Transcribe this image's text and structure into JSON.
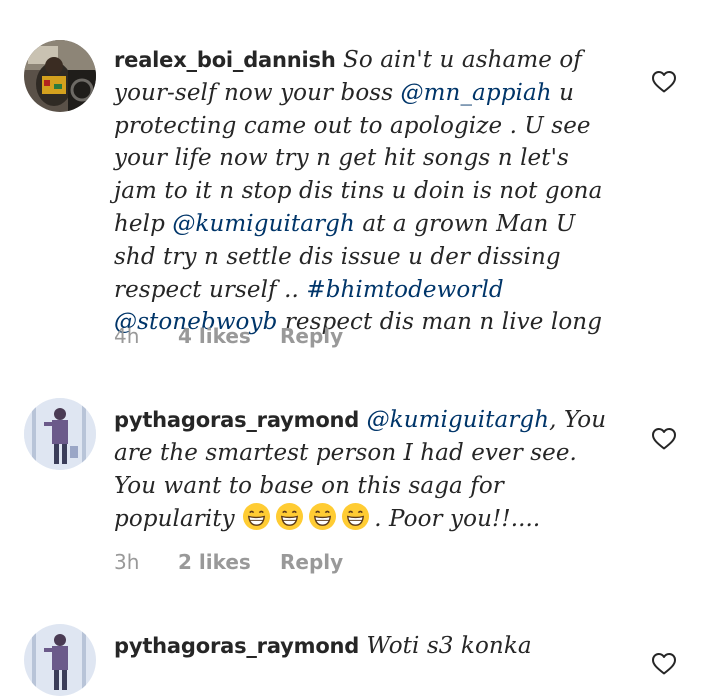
{
  "comments": [
    {
      "username": "realex_boi_dannish",
      "segments": [
        {
          "type": "text",
          "text": " So ain't u ashame of your-self now your boss "
        },
        {
          "type": "mention",
          "text": "@mn_appiah"
        },
        {
          "type": "text",
          "text": " u protecting came out to apologize . U see your life now try n get hit songs n let's jam to it n stop dis tins u doin is not gona help "
        },
        {
          "type": "mention",
          "text": "@kumiguitargh"
        },
        {
          "type": "text",
          "text": " at a grown Man U shd try n settle dis issue u der dissing respect urself .. "
        },
        {
          "type": "hashtag",
          "text": "#bhimtodeworld"
        },
        {
          "type": "text",
          "text": " "
        },
        {
          "type": "mention",
          "text": "@stonebwoyb"
        },
        {
          "type": "text",
          "text": " respect dis man n live long"
        }
      ],
      "time": "4h",
      "likes": "4 likes",
      "reply": "Reply",
      "avatar_icon": "profile-photo-car"
    },
    {
      "username": "pythagoras_raymond",
      "segments": [
        {
          "type": "text",
          "text": " "
        },
        {
          "type": "mention",
          "text": "@kumiguitargh"
        },
        {
          "type": "text",
          "text": ", You are the smartest person I had ever see. You want to base on this saga for popularity "
        },
        {
          "type": "emoji",
          "text": "grinning-face-with-smiling-eyes"
        },
        {
          "type": "emoji",
          "text": "grinning-face-with-smiling-eyes"
        },
        {
          "type": "emoji",
          "text": "grinning-face-with-smiling-eyes"
        },
        {
          "type": "emoji",
          "text": "grinning-face-with-smiling-eyes"
        },
        {
          "type": "text",
          "text": ". Poor you!!...."
        }
      ],
      "time": "3h",
      "likes": "2 likes",
      "reply": "Reply",
      "avatar_icon": "profile-photo-person-standing"
    },
    {
      "username": "pythagoras_raymond",
      "segments": [
        {
          "type": "text",
          "text": " Woti s3 konka"
        }
      ],
      "avatar_icon": "profile-photo-person-standing"
    }
  ],
  "icons": {
    "like": "heart-outline-icon"
  },
  "colors": {
    "text": "#262626",
    "link": "#003569",
    "meta": "#999999",
    "emoji_face": "#FFCC33"
  }
}
